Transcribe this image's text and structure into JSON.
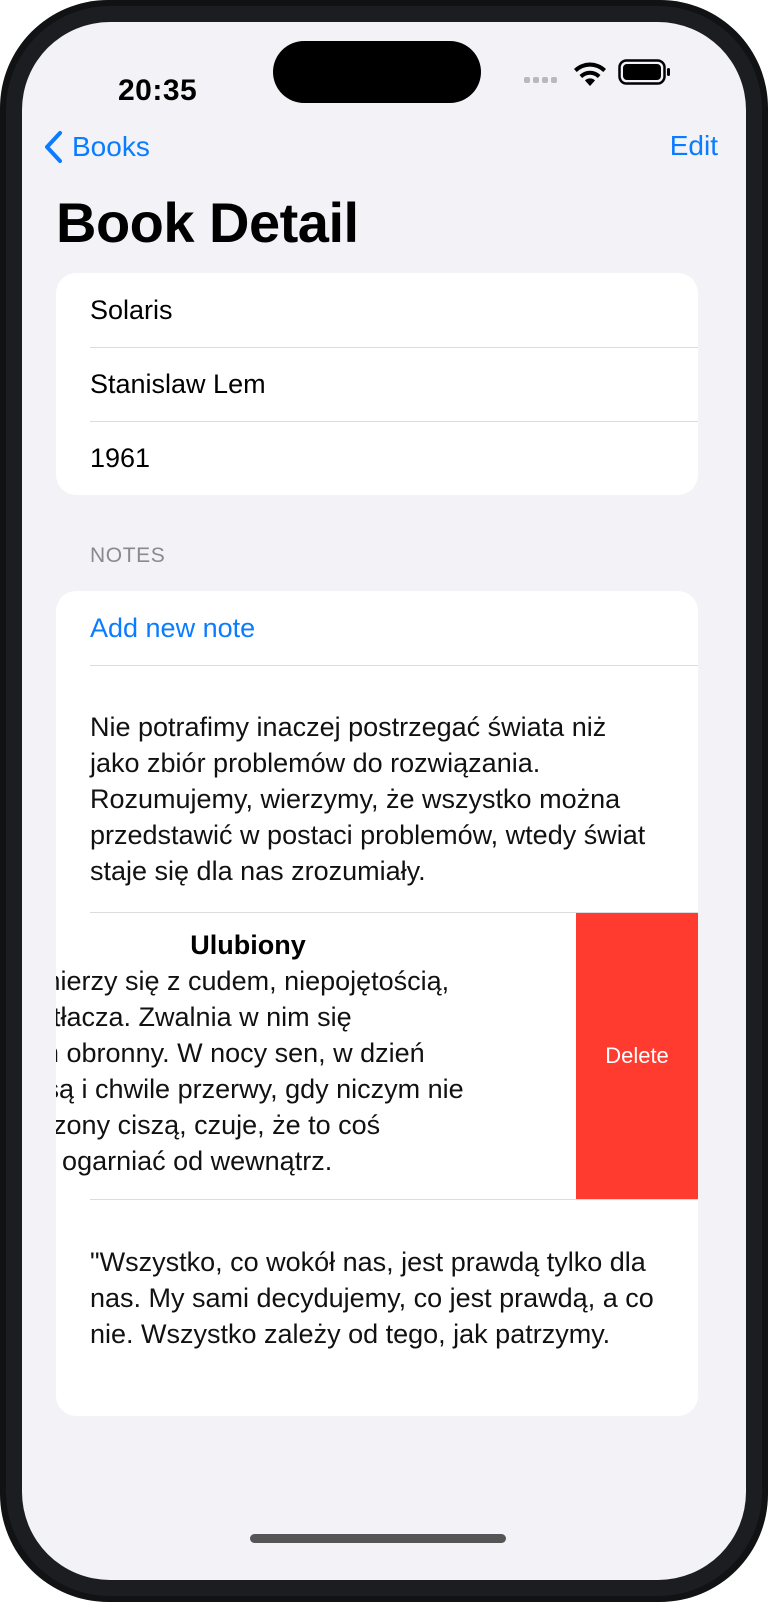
{
  "status_bar": {
    "time": "20:35"
  },
  "nav": {
    "back_label": "Books",
    "edit_label": "Edit",
    "title": "Book Detail"
  },
  "book": {
    "title": "Solaris",
    "author": "Stanislaw Lem",
    "year": "1961"
  },
  "notes": {
    "header": "NOTES",
    "add_label": "Add new note",
    "items": [
      {
        "title": "",
        "text": "Nie potrafimy inaczej postrzegać świata niż jako zbiór problemów do rozwiązania. Rozumujemy, wierzymy, że wszystko można przedstawić w postaci problemów, wtedy świat staje się dla nas zrozumiały."
      },
      {
        "title": "Ulubiony",
        "text": "ek mierzy się z cudem, niepojętością,\nprzytłacza. Zwalnia w nim się\nnizm obronny. W nocy sen, w dzień\nale są i chwile przerwy, gdy niczym nie\notoczony ciszą, czuje, że to coś\na go ogarniać od wewnątrz.",
        "action_label": "Delete"
      },
      {
        "title": "",
        "text": "\"Wszystko, co wokół nas, jest prawdą tylko dla nas. My sami decydujemy, co jest prawdą, a co nie. Wszystko zależy od tego, jak patrzymy."
      }
    ]
  },
  "colors": {
    "accent": "#0a7cff",
    "destructive": "#ff3b30",
    "background": "#f2f2f7"
  }
}
